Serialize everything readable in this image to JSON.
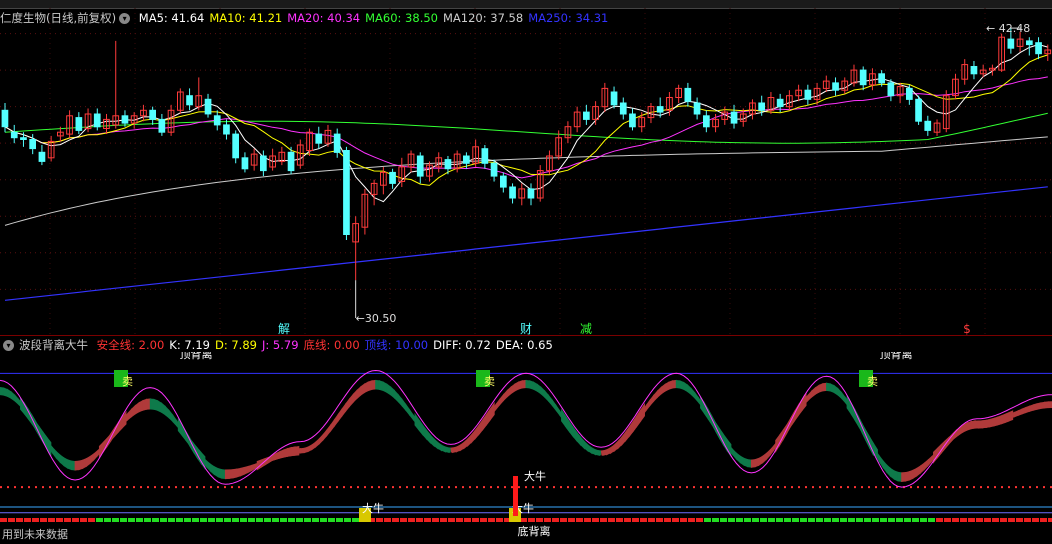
{
  "main_legend": {
    "title": "仁度生物(日线,前复权)",
    "items": [
      {
        "label": "MA5: 41.64",
        "color": "#ffffff"
      },
      {
        "label": "MA10: 41.21",
        "color": "#ffff00"
      },
      {
        "label": "MA20: 40.34",
        "color": "#ff33ff"
      },
      {
        "label": "MA60: 38.50",
        "color": "#33ff33"
      },
      {
        "label": "MA120: 37.58",
        "color": "#cccccc"
      },
      {
        "label": "MA250: 34.31",
        "color": "#3333ff"
      }
    ]
  },
  "sub_legend": {
    "title": "波段背离大牛",
    "items": [
      {
        "label": "安全线: 2.00",
        "color": "#ff3333"
      },
      {
        "label": "K: 7.19",
        "color": "#ffffff"
      },
      {
        "label": "D: 7.89",
        "color": "#ffff00"
      },
      {
        "label": "J: 5.79",
        "color": "#ff33ff"
      },
      {
        "label": "底线: 0.00",
        "color": "#ff3333"
      },
      {
        "label": "顶线: 10.00",
        "color": "#3333ff"
      },
      {
        "label": "DIFF: 0.72",
        "color": "#ffffff"
      },
      {
        "label": "DEA: 0.65",
        "color": "#ffffff"
      }
    ]
  },
  "bottom_text": "用到未来数据",
  "colors": {
    "up": "#ff3b3b",
    "down": "#54ffff",
    "ma5": "#ffffff",
    "ma10": "#ffff00",
    "ma20": "#ff33ff",
    "ma60": "#33ff33",
    "ma120": "#cccccc",
    "ma250": "#3333ff",
    "band_up": "#b03a3a",
    "band_down": "#0e7a4a"
  },
  "chart_data": [
    {
      "type": "candlestick",
      "title": "仁度生物(日线,前复权)",
      "ylim": [
        27.5,
        45.4
      ],
      "annotations": {
        "high": "42.48",
        "low": "30.50",
        "event_marks": [
          "解",
          "财",
          "减",
          "$"
        ]
      },
      "candles": [
        [
          39.8,
          38.9,
          40.2,
          38.6
        ],
        [
          38.6,
          38.3,
          39.0,
          38.0
        ],
        [
          38.3,
          38.2,
          38.6,
          37.8
        ],
        [
          38.2,
          37.7,
          38.5,
          37.4
        ],
        [
          37.5,
          37.0,
          37.9,
          36.8
        ],
        [
          37.2,
          38.1,
          38.4,
          37.0
        ],
        [
          38.4,
          38.6,
          38.9,
          38.1
        ],
        [
          38.5,
          39.5,
          39.8,
          38.3
        ],
        [
          39.4,
          38.7,
          39.7,
          38.5
        ],
        [
          38.8,
          39.6,
          39.9,
          38.6
        ],
        [
          39.6,
          38.9,
          39.9,
          38.7
        ],
        [
          38.8,
          39.3,
          39.6,
          38.5
        ],
        [
          39.0,
          39.5,
          43.6,
          38.8
        ],
        [
          39.5,
          39.1,
          39.8,
          38.9
        ],
        [
          39.1,
          39.5,
          39.7,
          38.8
        ],
        [
          39.5,
          39.8,
          40.1,
          39.2
        ],
        [
          39.8,
          39.3,
          40.0,
          39.0
        ],
        [
          39.3,
          38.6,
          39.6,
          38.4
        ],
        [
          38.6,
          39.8,
          40.1,
          38.4
        ],
        [
          39.8,
          40.8,
          41.0,
          39.6
        ],
        [
          40.6,
          40.1,
          41.0,
          39.8
        ],
        [
          40.0,
          40.6,
          41.6,
          39.8
        ],
        [
          40.4,
          39.6,
          40.7,
          39.4
        ],
        [
          39.5,
          39.0,
          39.8,
          38.7
        ],
        [
          39.0,
          38.5,
          39.3,
          38.2
        ],
        [
          38.5,
          37.2,
          38.7,
          36.9
        ],
        [
          37.2,
          36.6,
          37.5,
          36.4
        ],
        [
          36.8,
          37.4,
          37.7,
          36.5
        ],
        [
          37.3,
          36.5,
          37.6,
          36.2
        ],
        [
          36.7,
          37.3,
          37.7,
          36.5
        ],
        [
          37.0,
          37.5,
          37.8,
          36.8
        ],
        [
          37.5,
          36.5,
          37.8,
          36.3
        ],
        [
          36.8,
          37.9,
          38.2,
          36.6
        ],
        [
          37.6,
          38.6,
          38.8,
          37.3
        ],
        [
          38.5,
          38.0,
          38.9,
          37.7
        ],
        [
          38.0,
          38.7,
          39.0,
          37.8
        ],
        [
          38.5,
          37.5,
          38.8,
          37.2
        ],
        [
          37.6,
          33.0,
          37.8,
          32.7
        ],
        [
          32.6,
          33.6,
          34.0,
          30.5
        ],
        [
          33.4,
          35.2,
          35.5,
          33.0
        ],
        [
          35.2,
          35.8,
          36.0,
          34.6
        ],
        [
          35.7,
          36.4,
          36.7,
          35.2
        ],
        [
          36.4,
          35.8,
          36.6,
          35.5
        ],
        [
          35.9,
          36.7,
          37.2,
          35.6
        ],
        [
          36.7,
          37.4,
          37.6,
          36.4
        ],
        [
          37.3,
          36.2,
          37.5,
          35.8
        ],
        [
          36.2,
          36.8,
          37.0,
          35.9
        ],
        [
          36.7,
          37.2,
          37.5,
          36.4
        ],
        [
          37.1,
          36.6,
          37.3,
          36.3
        ],
        [
          36.6,
          37.4,
          37.6,
          36.4
        ],
        [
          37.3,
          36.9,
          37.5,
          36.6
        ],
        [
          36.9,
          37.8,
          38.2,
          36.7
        ],
        [
          37.7,
          36.9,
          37.9,
          36.6
        ],
        [
          36.9,
          36.2,
          37.1,
          35.9
        ],
        [
          36.2,
          35.6,
          36.4,
          35.3
        ],
        [
          35.6,
          35.0,
          35.8,
          34.7
        ],
        [
          35.0,
          35.5,
          35.8,
          34.6
        ],
        [
          35.5,
          35.0,
          35.8,
          34.6
        ],
        [
          35.0,
          36.5,
          36.8,
          34.8
        ],
        [
          36.5,
          37.3,
          37.6,
          36.3
        ],
        [
          37.3,
          38.3,
          38.7,
          37.1
        ],
        [
          38.3,
          38.9,
          39.2,
          38.0
        ],
        [
          38.9,
          39.7,
          40.0,
          38.6
        ],
        [
          39.7,
          39.3,
          40.1,
          39.0
        ],
        [
          39.3,
          40.0,
          40.3,
          39.0
        ],
        [
          40.0,
          41.0,
          41.3,
          39.7
        ],
        [
          40.8,
          40.1,
          41.1,
          39.9
        ],
        [
          40.2,
          39.6,
          40.5,
          39.3
        ],
        [
          39.6,
          38.9,
          39.9,
          38.7
        ],
        [
          38.9,
          39.4,
          39.7,
          38.6
        ],
        [
          39.4,
          40.0,
          40.2,
          39.1
        ],
        [
          40.0,
          39.7,
          40.5,
          39.4
        ],
        [
          39.8,
          40.5,
          40.8,
          39.5
        ],
        [
          40.5,
          41.0,
          41.2,
          40.2
        ],
        [
          41.0,
          40.3,
          41.3,
          40.0
        ],
        [
          40.2,
          39.6,
          40.5,
          39.3
        ],
        [
          39.5,
          38.9,
          39.8,
          38.6
        ],
        [
          38.9,
          39.3,
          39.6,
          38.6
        ],
        [
          39.3,
          39.7,
          40.0,
          39.0
        ],
        [
          39.7,
          39.1,
          40.1,
          38.8
        ],
        [
          39.2,
          39.6,
          39.9,
          38.9
        ],
        [
          39.6,
          40.2,
          40.4,
          39.3
        ],
        [
          40.2,
          39.8,
          40.6,
          39.5
        ],
        [
          39.8,
          40.5,
          40.8,
          39.6
        ],
        [
          40.4,
          40.0,
          40.7,
          39.7
        ],
        [
          40.0,
          40.6,
          40.9,
          39.8
        ],
        [
          40.6,
          40.9,
          41.2,
          40.3
        ],
        [
          40.9,
          40.4,
          41.2,
          40.1
        ],
        [
          40.4,
          41.0,
          41.3,
          40.1
        ],
        [
          41.0,
          41.4,
          41.7,
          40.8
        ],
        [
          41.3,
          40.9,
          41.6,
          40.6
        ],
        [
          40.9,
          41.4,
          41.6,
          40.7
        ],
        [
          41.3,
          42.0,
          42.3,
          41.1
        ],
        [
          42.0,
          41.2,
          42.2,
          40.9
        ],
        [
          41.2,
          41.8,
          42.1,
          40.9
        ],
        [
          41.8,
          41.3,
          42.0,
          41.1
        ],
        [
          41.3,
          40.6,
          41.5,
          40.3
        ],
        [
          40.6,
          41.1,
          41.3,
          40.2
        ],
        [
          41.0,
          40.4,
          41.2,
          40.1
        ],
        [
          40.4,
          39.2,
          40.6,
          39.0
        ],
        [
          39.2,
          38.7,
          39.5,
          38.4
        ],
        [
          38.6,
          39.1,
          39.3,
          38.4
        ],
        [
          38.8,
          40.6,
          40.9,
          38.6
        ],
        [
          40.6,
          41.5,
          41.8,
          40.4
        ],
        [
          41.5,
          42.3,
          42.6,
          41.2
        ],
        [
          42.2,
          41.8,
          42.5,
          41.5
        ],
        [
          41.8,
          42.0,
          42.3,
          41.6
        ],
        [
          42.0,
          42.1,
          42.3,
          41.7
        ],
        [
          42.0,
          43.8,
          44.0,
          41.9
        ],
        [
          43.7,
          43.2,
          44.3,
          42.9
        ],
        [
          43.3,
          43.7,
          44.1,
          43.0
        ],
        [
          43.6,
          43.4,
          43.8,
          42.8
        ],
        [
          43.5,
          42.9,
          43.8,
          42.6
        ],
        [
          42.9,
          43.1,
          43.4,
          42.5
        ]
      ]
    },
    {
      "type": "line",
      "title": "波段背离大牛",
      "ylim": [
        -2,
        11.5
      ],
      "reference_lines": {
        "安全线": 2.0,
        "底线": 0.0,
        "顶线": 10.0
      },
      "x": [
        0,
        8,
        16,
        24,
        32,
        40,
        48,
        56,
        64,
        72,
        80,
        88,
        96,
        104,
        112
      ],
      "series": [
        {
          "name": "J",
          "values": [
            9.5,
            2.5,
            9.0,
            2.2,
            5.2,
            10.2,
            5.0,
            10.0,
            4.8,
            10.0,
            3.0,
            9.8,
            2.0,
            6.8,
            8.5
          ]
        },
        {
          "name": "K",
          "values": [
            9.0,
            3.2,
            8.2,
            2.6,
            4.7,
            9.5,
            4.6,
            9.5,
            4.4,
            9.5,
            3.4,
            9.3,
            2.4,
            6.5,
            8.0
          ]
        },
        {
          "name": "D",
          "values": [
            8.5,
            3.8,
            7.5,
            3.2,
            4.4,
            8.9,
            4.6,
            9.0,
            4.4,
            9.0,
            3.9,
            8.8,
            3.0,
            6.3,
            7.6
          ]
        }
      ],
      "markers": {
        "sell": [
          "卖",
          "卖",
          "卖"
        ],
        "bull": [
          "大牛",
          "大牛",
          "大牛"
        ],
        "top_divergence": [
          "顶背离",
          "顶背离"
        ],
        "bottom_divergence": "底背离"
      }
    }
  ]
}
